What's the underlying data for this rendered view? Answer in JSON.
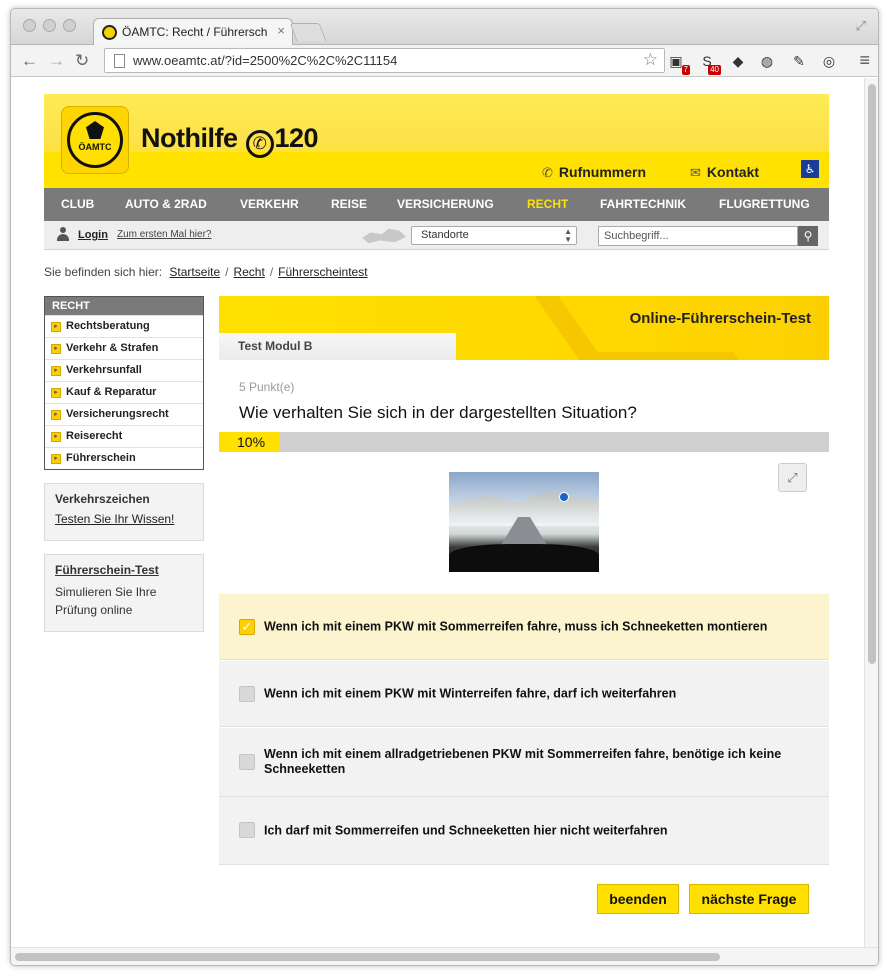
{
  "browser": {
    "tab_title": "ÖAMTC: Recht / Führersch",
    "tab_close": "×",
    "url": "www.oeamtc.at/?id=2500%2C%2C%2C11154",
    "back_glyph": "←",
    "forward_glyph": "→",
    "reload_glyph": "↻",
    "star_glyph": "☆",
    "menu_glyph": "≡",
    "resize_glyph": "⤢",
    "extensions": [
      {
        "name": "screen-capture-icon",
        "glyph": "▣",
        "badge": "7"
      },
      {
        "name": "skype-icon",
        "glyph": "S",
        "badge": "40"
      },
      {
        "name": "bookmark-icon",
        "glyph": "◆",
        "badge": ""
      },
      {
        "name": "globe-icon",
        "glyph": "◍",
        "badge": ""
      },
      {
        "name": "eyedropper-icon",
        "glyph": "✎",
        "badge": ""
      },
      {
        "name": "wave-icon",
        "glyph": "◎",
        "badge": ""
      }
    ]
  },
  "header": {
    "logo_text": "ÖAMTC",
    "hotline_prefix": "Nothilfe",
    "hotline_phone_glyph": "✆",
    "hotline_number": "120",
    "links": [
      {
        "label": "Rufnummern",
        "icon_glyph": "✆"
      },
      {
        "label": "Kontakt",
        "icon_glyph": "✉"
      }
    ],
    "accessibility_glyph": "♿"
  },
  "mainnav": [
    {
      "label": "CLUB",
      "active": false
    },
    {
      "label": "AUTO & 2RAD",
      "active": false
    },
    {
      "label": "VERKEHR",
      "active": false
    },
    {
      "label": "REISE",
      "active": false
    },
    {
      "label": "VERSICHERUNG",
      "active": false
    },
    {
      "label": "RECHT",
      "active": true
    },
    {
      "label": "FAHRTECHNIK",
      "active": false
    },
    {
      "label": "FLUGRETTUNG",
      "active": false
    }
  ],
  "subbar": {
    "login": "Login",
    "first_time": "Zum ersten Mal hier?",
    "locations_select": "Standorte",
    "search_placeholder": "Suchbegriff...",
    "search_glyph": "⚲"
  },
  "breadcrumb": {
    "prefix": "Sie befinden sich hier:",
    "items": [
      "Startseite",
      "Recht",
      "Führerscheintest"
    ],
    "separator": "/"
  },
  "sidebar": {
    "heading": "RECHT",
    "items": [
      "Rechtsberatung",
      "Verkehr & Strafen",
      "Verkehrsunfall",
      "Kauf & Reparatur",
      "Versicherungsrecht",
      "Reiserecht",
      "Führerschein"
    ],
    "panels": [
      {
        "title": "Verkehrszeichen",
        "text": "Testen Sie Ihr Wissen!"
      },
      {
        "title": "Führerschein-Test",
        "text": "Simulieren Sie Ihre Prüfung online"
      }
    ]
  },
  "quiz": {
    "banner_title": "Online-Führerschein-Test",
    "module": "Test Modul B",
    "points": "5 Punkt(e)",
    "question": "Wie verhalten Sie sich in der dargestellten Situation?",
    "progress_label": "10%",
    "progress_fraction": 0.1,
    "expand_glyph": "⤢",
    "answers": [
      {
        "text": "Wenn ich mit einem PKW mit Sommerreifen fahre, muss ich Schneeketten montieren",
        "checked": true
      },
      {
        "text": "Wenn ich mit einem PKW mit Winterreifen fahre, darf ich weiterfahren",
        "checked": false
      },
      {
        "text": "Wenn ich mit einem allradgetriebenen PKW mit Sommerreifen fahre, benötige ich keine Schneeketten",
        "checked": false
      },
      {
        "text": "Ich darf mit Sommerreifen und Schneeketten hier nicht weiterfahren",
        "checked": false
      }
    ],
    "check_glyph": "✓",
    "end_button": "beenden",
    "next_button": "nächste Frage"
  },
  "colors": {
    "brand_yellow": "#ffe000",
    "nav_gray": "#7a7a7a",
    "selected_answer_bg": "#fbf4cf"
  }
}
